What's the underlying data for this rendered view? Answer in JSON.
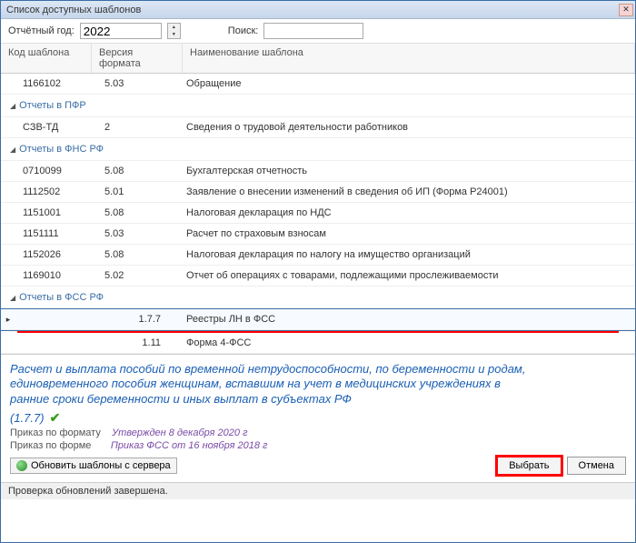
{
  "window": {
    "title": "Список доступных шаблонов"
  },
  "filter": {
    "year_label": "Отчётный год:",
    "year_value": "2022",
    "search_label": "Поиск:",
    "search_value": ""
  },
  "columns": {
    "code": "Код шаблона",
    "version": "Версия формата",
    "name": "Наименование шаблона"
  },
  "rows": {
    "r0": {
      "code": "1166102",
      "ver": "5.03",
      "name": "Обращение"
    },
    "g1": "Отчеты в ПФР",
    "r1": {
      "code": "СЗВ-ТД",
      "ver": "2",
      "name": "Сведения о трудовой деятельности работников"
    },
    "g2": "Отчеты в ФНС РФ",
    "r2": {
      "code": "0710099",
      "ver": "5.08",
      "name": "Бухгалтерская отчетность"
    },
    "r3": {
      "code": "1112502",
      "ver": "5.01",
      "name": "Заявление о внесении изменений в сведения об ИП (Форма Р24001)"
    },
    "r4": {
      "code": "1151001",
      "ver": "5.08",
      "name": "Налоговая декларация по НДС"
    },
    "r5": {
      "code": "1151111",
      "ver": "5.03",
      "name": "Расчет по страховым взносам"
    },
    "r6": {
      "code": "1152026",
      "ver": "5.08",
      "name": "Налоговая декларация по налогу на имущество организаций"
    },
    "r7": {
      "code": "1169010",
      "ver": "5.02",
      "name": "Отчет об операциях с товарами, подлежащими прослеживаемости"
    },
    "g3": "Отчеты в ФСС РФ",
    "sel": {
      "code": "",
      "ver": "1.7.7",
      "name": "Реестры ЛН в ФСС"
    },
    "r8": {
      "code": "",
      "ver": "1.11",
      "name": "Форма 4-ФСС"
    }
  },
  "detail": {
    "desc_l1": "Расчет и выплата пособий по временной нетрудоспособности, по беременности и родам,",
    "desc_l2": "единовременного пособия женщинам, вставшим на учет в медицинских учреждениях в",
    "desc_l3": "ранние сроки беременности и иных выплат в субъектах РФ",
    "version": "(1.7.7)",
    "format_label": "Приказ по формату",
    "format_link": "Утвержден 8 декабря 2020 г",
    "form_label": "Приказ по форме",
    "form_link": "Приказ ФСС от 16 ноября 2018 г",
    "update_btn": "Обновить шаблоны с сервера",
    "select_btn": "Выбрать",
    "cancel_btn": "Отмена"
  },
  "status": "Проверка обновлений завершена."
}
